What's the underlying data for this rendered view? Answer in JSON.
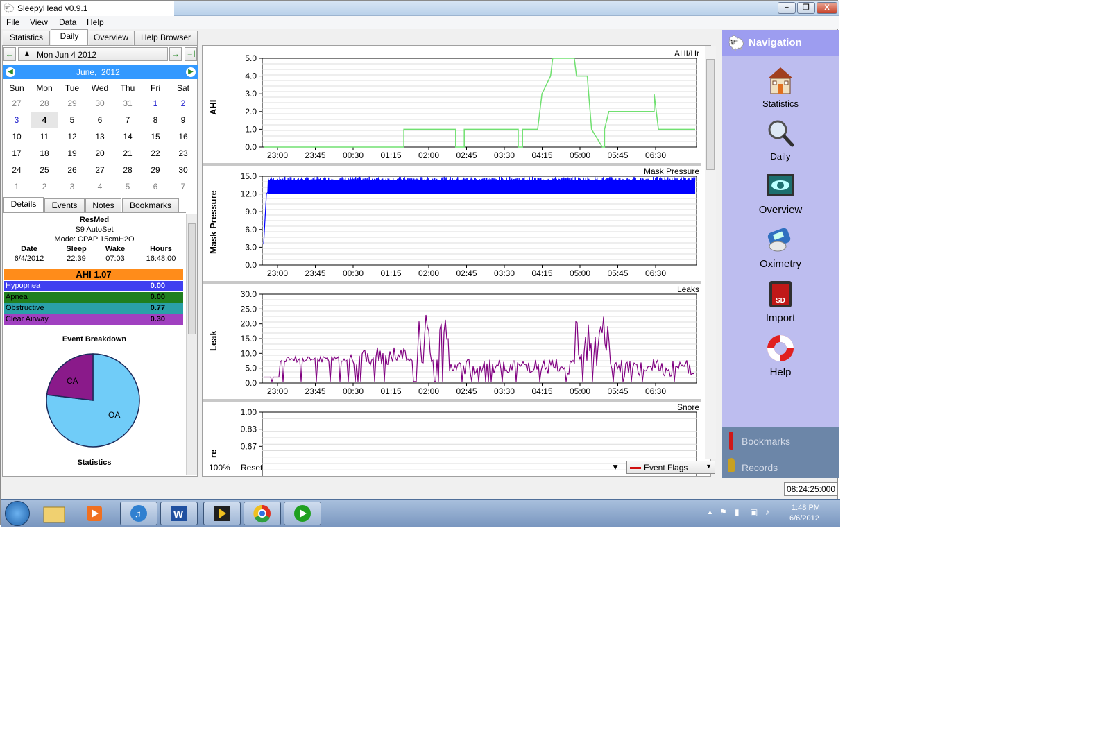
{
  "window": {
    "title": "SleepyHead v0.9.1",
    "minimize": "−",
    "restore": "❐",
    "close": "X"
  },
  "menu": [
    "File",
    "View",
    "Data",
    "Help"
  ],
  "tabs": [
    "Statistics",
    "Daily",
    "Overview",
    "Help Browser"
  ],
  "date_selector": {
    "date": "Mon Jun 4 2012",
    "prev": "←",
    "next": "→",
    "last": "→|"
  },
  "calendar": {
    "month": "June",
    "year": "2012",
    "weekdays": [
      "Sun",
      "Mon",
      "Tue",
      "Wed",
      "Thu",
      "Fri",
      "Sat"
    ],
    "weeks": [
      [
        "27",
        "28",
        "29",
        "30",
        "31",
        "1",
        "2"
      ],
      [
        "3",
        "4",
        "5",
        "6",
        "7",
        "8",
        "9"
      ],
      [
        "10",
        "11",
        "12",
        "13",
        "14",
        "15",
        "16"
      ],
      [
        "17",
        "18",
        "19",
        "20",
        "21",
        "22",
        "23"
      ],
      [
        "24",
        "25",
        "26",
        "27",
        "28",
        "29",
        "30"
      ],
      [
        "1",
        "2",
        "3",
        "4",
        "5",
        "6",
        "7"
      ]
    ],
    "selected": "4"
  },
  "detail_tabs": [
    "Details",
    "Events",
    "Notes",
    "Bookmarks"
  ],
  "details": {
    "brand": "ResMed",
    "model": "S9 AutoSet",
    "mode": "Mode: CPAP 15cmH2O",
    "headers": [
      "Date",
      "Sleep",
      "Wake",
      "Hours"
    ],
    "values": [
      "6/4/2012",
      "22:39",
      "07:03",
      "16:48:00"
    ],
    "ahi": "AHI 1.07",
    "stats": [
      {
        "label": "Hypopnea",
        "value": "0.00",
        "color": "#4040f0"
      },
      {
        "label": "Apnea",
        "value": "0.00",
        "color": "#1f7f1f"
      },
      {
        "label": "Obstructive",
        "value": "0.77",
        "color": "#2aa0a8"
      },
      {
        "label": "Clear Airway",
        "value": "0.30",
        "color": "#a040c0"
      }
    ],
    "breakdown_title": "Event Breakdown",
    "pie": {
      "slices": [
        {
          "label": "CA",
          "value": 0.3,
          "color": "#8a1a8a"
        },
        {
          "label": "OA",
          "value": 0.77,
          "color": "#70ccf8"
        }
      ]
    },
    "statistics_label": "Statistics"
  },
  "charts": {
    "x_ticks": [
      "23:00",
      "23:45",
      "00:30",
      "01:15",
      "02:00",
      "02:45",
      "03:30",
      "04:15",
      "05:00",
      "05:45",
      "06:30"
    ],
    "ahi": {
      "ylabel": "AHI",
      "title": "AHI/Hr",
      "ticks": [
        "5.0",
        "4.0",
        "3.0",
        "2.0",
        "1.0",
        "0.0"
      ],
      "color": "#70e070"
    },
    "pressure": {
      "ylabel": "Mask Pressure",
      "title": "Mask Pressure",
      "ticks": [
        "15.0",
        "12.0",
        "9.0",
        "6.0",
        "3.0",
        "0.0"
      ],
      "color": "#0000ff"
    },
    "leak": {
      "ylabel": "Leak",
      "title": "Leaks",
      "ticks": [
        "30.0",
        "25.0",
        "20.0",
        "15.0",
        "10.0",
        "5.0",
        "0.0"
      ],
      "color": "#800080"
    },
    "snore": {
      "ylabel": "re",
      "title": "Snore",
      "ticks": [
        "1.00",
        "0.83",
        "0.67"
      ]
    }
  },
  "bottom": {
    "zoom": "100%",
    "reset": "Reset",
    "event_flags": "Event Flags"
  },
  "navigation": {
    "title": "Navigation",
    "items": [
      "Statistics",
      "Daily",
      "Overview",
      "Oximetry",
      "Import",
      "Help"
    ],
    "footer": [
      "Bookmarks",
      "Records"
    ]
  },
  "status": {
    "clock": "08:24:25:000"
  },
  "taskbar": {
    "time": "1:48 PM",
    "date": "6/6/2012"
  }
}
